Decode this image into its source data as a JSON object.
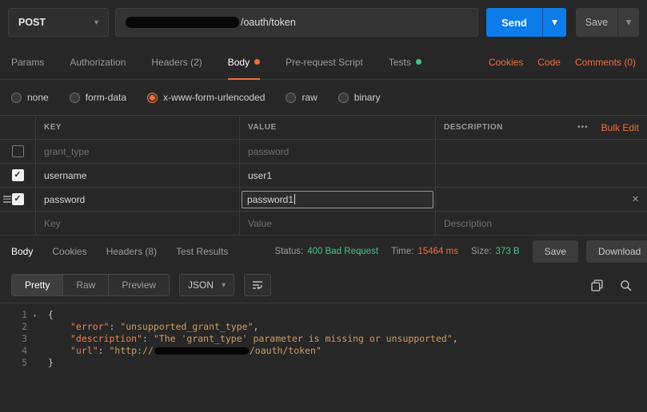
{
  "colors": {
    "accent": "#f26b3a",
    "blue": "#0d7ce8",
    "green": "#45c38a",
    "bg": "#272727",
    "border": "#3d3d3d"
  },
  "topbar": {
    "method": "POST",
    "url_path": "/oauth/token",
    "send": "Send",
    "save": "Save"
  },
  "request_tabs": {
    "params": "Params",
    "authorization": "Authorization",
    "headers": "Headers (2)",
    "body": "Body",
    "prerequest": "Pre-request Script",
    "tests": "Tests",
    "cookies": "Cookies",
    "code": "Code",
    "comments": "Comments (0)"
  },
  "body_modes": {
    "none": "none",
    "form_data": "form-data",
    "urlencoded": "x-www-form-urlencoded",
    "raw": "raw",
    "binary": "binary",
    "selected": "x-www-form-urlencoded"
  },
  "kv_table": {
    "key_header": "KEY",
    "value_header": "VALUE",
    "description_header": "DESCRIPTION",
    "more_icon": "•••",
    "bulk_edit": "Bulk Edit",
    "rows": [
      {
        "key": "grant_type",
        "value": "password",
        "check": ""
      },
      {
        "key": "username",
        "value": "user1",
        "check": "✓"
      },
      {
        "key": "password",
        "value": "password1",
        "check": "✓"
      }
    ],
    "placeholder": {
      "key": "Key",
      "value": "Value",
      "description": "Description"
    }
  },
  "response": {
    "tab_body": "Body",
    "tab_cookies": "Cookies",
    "tab_headers": "Headers (8)",
    "tab_tests": "Test Results",
    "status_label": "Status:",
    "status_value": "400 Bad Request",
    "time_label": "Time:",
    "time_value": "15464 ms",
    "size_label": "Size:",
    "size_value": "373 B",
    "save": "Save",
    "download": "Download",
    "view_pretty": "Pretty",
    "view_raw": "Raw",
    "view_preview": "Preview",
    "format": "JSON"
  },
  "code": {
    "lines": [
      {
        "num": "1",
        "open": "{"
      },
      {
        "num": "2",
        "key": "\"error\"",
        "colon": ": ",
        "value": "\"unsupported_grant_type\"",
        "comma": ","
      },
      {
        "num": "3",
        "key": "\"description\"",
        "colon": ": ",
        "value": "\"The 'grant_type' parameter is missing or unsupported\"",
        "comma": ","
      },
      {
        "num": "4",
        "key": "\"url\"",
        "colon": ": ",
        "value_prefix": "\"http://",
        "value_suffix": "/oauth/token\""
      },
      {
        "num": "5",
        "close": "}"
      }
    ]
  }
}
